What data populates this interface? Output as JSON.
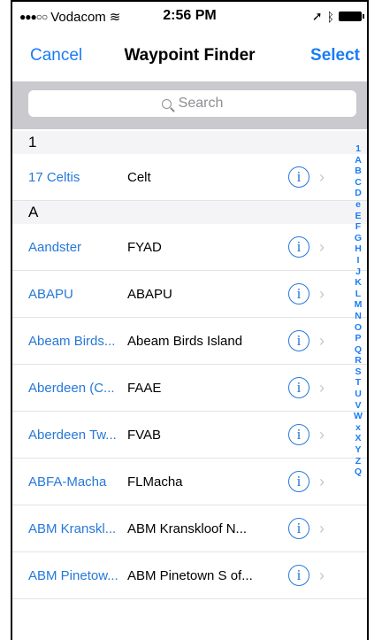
{
  "status": {
    "carrier": "Vodacom",
    "time": "2:56 PM"
  },
  "nav": {
    "cancel": "Cancel",
    "title": "Waypoint Finder",
    "select": "Select"
  },
  "search": {
    "placeholder": "Search"
  },
  "sections": [
    {
      "header": "1",
      "rows": [
        {
          "name": "17 Celtis",
          "code": "Celt"
        }
      ]
    },
    {
      "header": "A",
      "rows": [
        {
          "name": "Aandster",
          "code": "FYAD"
        },
        {
          "name": "ABAPU",
          "code": "ABAPU"
        },
        {
          "name": "Abeam Birds...",
          "code": "Abeam Birds Island"
        },
        {
          "name": "Aberdeen (C...",
          "code": "FAAE"
        },
        {
          "name": "Aberdeen Tw...",
          "code": "FVAB"
        },
        {
          "name": "ABFA-Macha",
          "code": "FLMacha"
        },
        {
          "name": "ABM Kranskl...",
          "code": "ABM Kranskloof N..."
        },
        {
          "name": "ABM Pinetow...",
          "code": "ABM Pinetown S of..."
        }
      ]
    }
  ],
  "index": [
    "1",
    "A",
    "B",
    "C",
    "D",
    "e",
    "E",
    "F",
    "G",
    "H",
    "I",
    "J",
    "K",
    "L",
    "M",
    "N",
    "O",
    "P",
    "Q",
    "R",
    "S",
    "T",
    "U",
    "V",
    "W",
    "x",
    "X",
    "Y",
    "Z",
    "Q"
  ],
  "colors": {
    "accent": "#1a7cf5",
    "link": "#2678d8",
    "search_bg": "#c9c9ce"
  },
  "icons": {
    "info": "info-circle-icon",
    "chevron": "chevron-right-icon",
    "search": "search-icon"
  }
}
